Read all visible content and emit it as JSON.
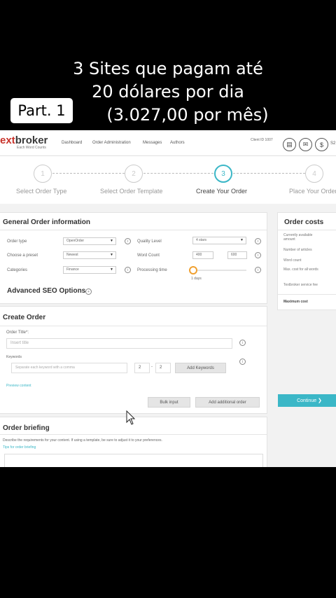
{
  "overlay": {
    "caption_line1": "3 Sites que pagam até",
    "caption_line2": "20 dólares por dia",
    "caption_line3": "(3.027,00 por mês)",
    "badge": "Part. 1"
  },
  "header": {
    "logo_prefix": "ext",
    "logo_main": "broker",
    "logo_sub": "Each Word Counts",
    "nav": [
      "Dashboard",
      "Order Administration",
      "Messages",
      "Authors"
    ],
    "client_id": "Client ID 1007",
    "icons": [
      "document-icon",
      "mail-icon",
      "dollar-icon"
    ],
    "user_tail": "S2"
  },
  "stepper": {
    "steps": [
      {
        "number": "1",
        "label": "Select Order Type",
        "active": false
      },
      {
        "number": "2",
        "label": "Select Order Template",
        "active": false
      },
      {
        "number": "3",
        "label": "Create Your Order",
        "active": true
      },
      {
        "number": "4",
        "label": "Place Your Order",
        "active": false
      }
    ]
  },
  "general": {
    "title": "General Order information",
    "order_type_label": "Order type",
    "order_type_value": "OpenOrder",
    "quality_label": "Quality Level",
    "quality_value": "4 stars",
    "preset_label": "Choose a preset",
    "preset_value": "Newest",
    "word_count_label": "Word Count",
    "word_min": "400",
    "word_max": "600",
    "categories_label": "Categories",
    "categories_value": "Finance",
    "processing_label": "Processing time",
    "processing_value": "1 days",
    "seo_label": "Advanced SEO Options"
  },
  "create": {
    "title": "Create Order",
    "order_title_label": "Order Title*:",
    "order_title_placeholder": "Insert title",
    "keywords_label": "Keywords",
    "keywords_placeholder": "Separate each keyword with a comma",
    "kw_min": "2",
    "kw_max": "2",
    "add_keywords": "Add Keywords",
    "preview_link": "Preview content",
    "bulk_input": "Bulk input",
    "add_order": "Add additional order"
  },
  "briefing": {
    "title": "Order briefing",
    "text": "Describe the requirements for your content. If using a template, be sure to adjust it to your preferences.",
    "link": "Tips for order briefing"
  },
  "costs": {
    "title": "Order costs",
    "rows": [
      "Currently available amount",
      "Number of articles",
      "Word count",
      "Max. cost for all words",
      "Textbroker service fee"
    ],
    "max_label": "Maximum cost",
    "continue": "Continue"
  }
}
